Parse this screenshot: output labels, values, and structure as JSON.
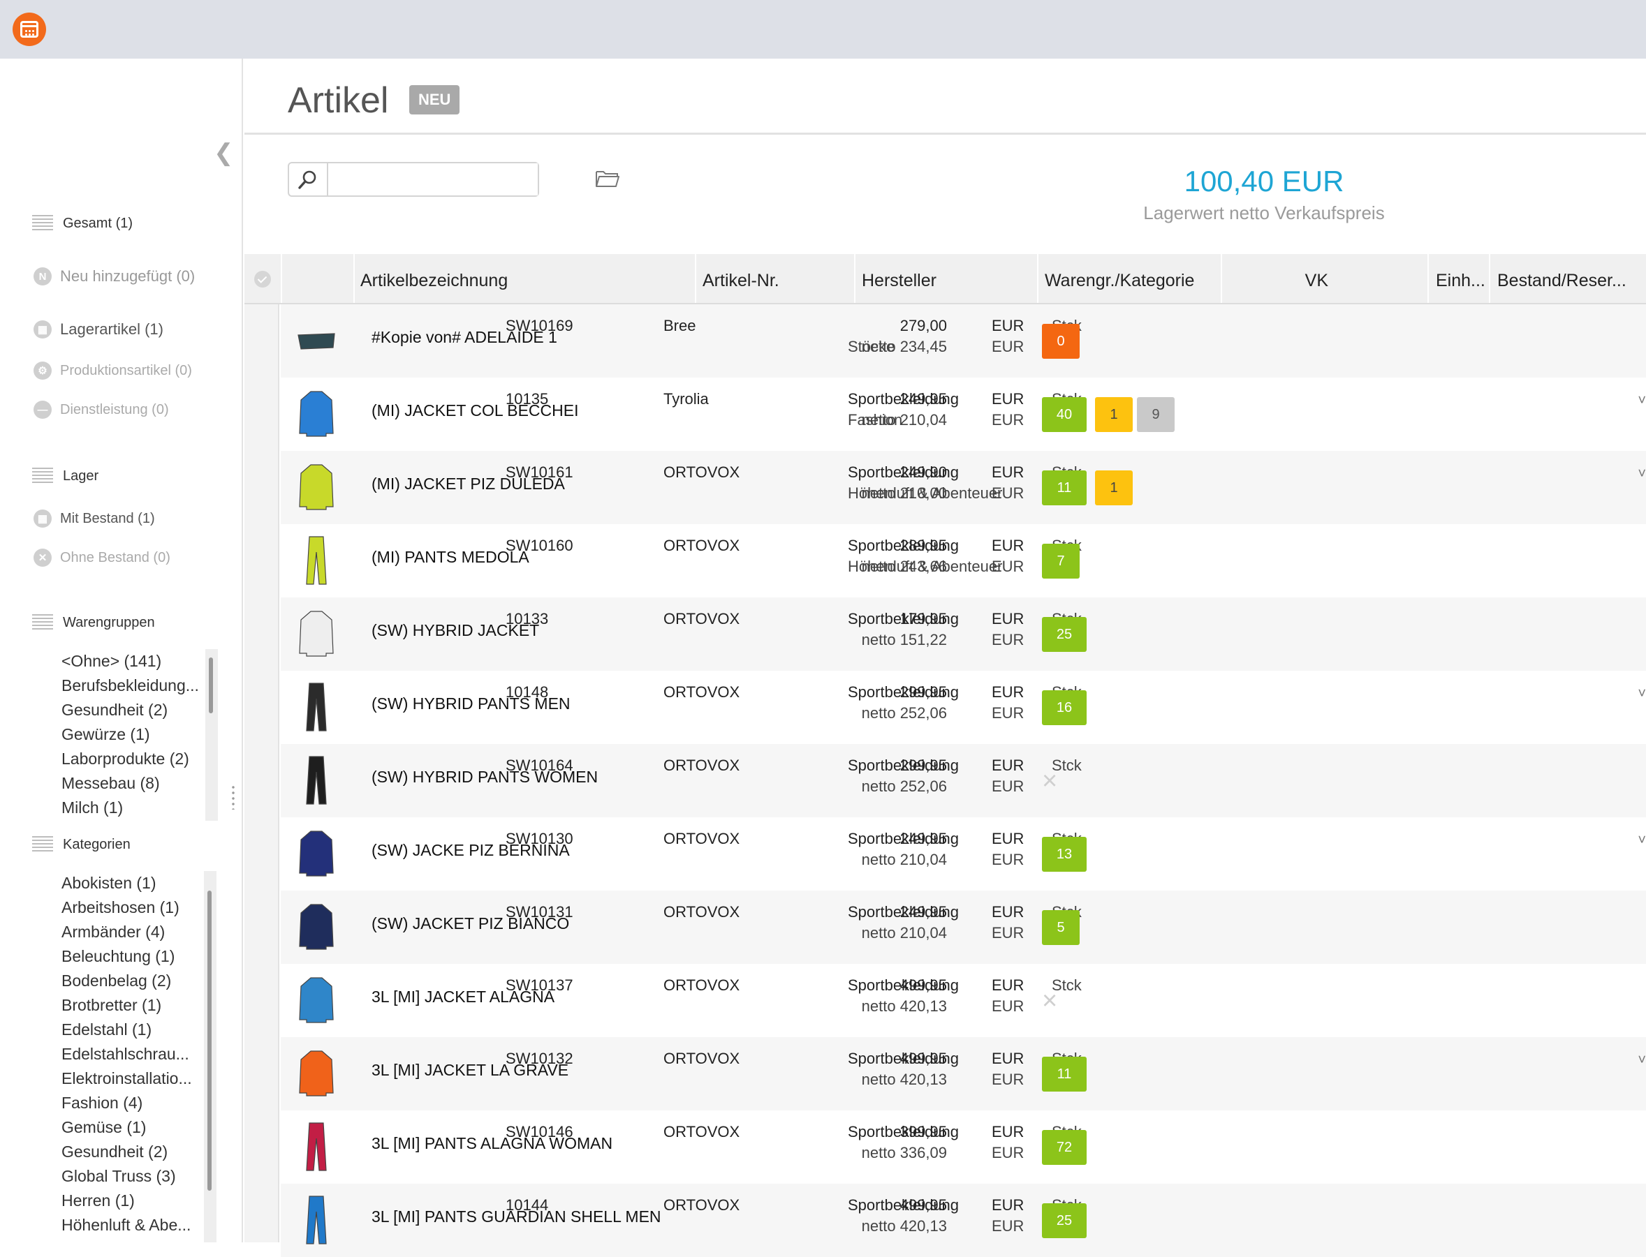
{
  "sidebar": {
    "gesamt": "Gesamt (1)",
    "neu": "Neu hinzugefügt (0)",
    "lagerartikel": "Lagerartikel (1)",
    "produktion": "Produktionsartikel (0)",
    "dienstleistung": "Dienstleistung (0)",
    "lager": "Lager",
    "mit_bestand": "Mit Bestand (1)",
    "ohne_bestand": "Ohne Bestand (0)",
    "warengruppen": "Warengruppen",
    "warengruppen_items": [
      "<Ohne> (141)",
      "Berufsbekleidung...",
      "Gesundheit (2)",
      "Gewürze (1)",
      "Laborprodukte (2)",
      "Messebau (8)",
      "Milch (1)"
    ],
    "kategorien": "Kategorien",
    "kategorien_items": [
      "Abokisten (1)",
      "Arbeitshosen (1)",
      "Armbänder (4)",
      "Beleuchtung (1)",
      "Bodenbelag (2)",
      "Brotbretter (1)",
      "Edelstahl (1)",
      "Edelstahlschrau...",
      "Elektroinstallatio...",
      "Fashion (4)",
      "Gemüse (1)",
      "Gesundheit (2)",
      "Global Truss (3)",
      "Herren (1)",
      "Höhenluft & Abe..."
    ]
  },
  "header": {
    "title": "Artikel",
    "badge": "NEU",
    "stock_value": "100,40 EUR",
    "stock_label": "Lagerwert netto Verkaufspreis"
  },
  "search": {
    "placeholder": ""
  },
  "table": {
    "columns": {
      "name": "Artikelbezeichnung",
      "nr": "Artikel-Nr.",
      "manufacturer": "Hersteller",
      "category": "Warengr./Kategorie",
      "vk": "VK",
      "unit": "Einh...",
      "stock": "Bestand/Reser..."
    },
    "rows": [
      {
        "name": "#Kopie von# ADELAIDE 1",
        "nr": "SW10169",
        "manufacturer": "Bree",
        "cat1": "",
        "cat2": "Stöcke",
        "vk": "279,00",
        "netto": "netto 234,45",
        "cur": "EUR",
        "unit": "Stck",
        "stock": [
          {
            "v": "0",
            "type": "orange"
          }
        ],
        "img": "bag",
        "color": "#2f4a52"
      },
      {
        "name": "(MI) JACKET COL BECCHEI",
        "nr": "10135",
        "manufacturer": "Tyrolia",
        "cat1": "Sportbekleidung",
        "cat2": "Fashion",
        "vk": "249,95",
        "netto": "netto 210,04",
        "cur": "EUR",
        "unit": "Stck",
        "stock": [
          {
            "v": "40",
            "type": "green"
          },
          {
            "v": "1",
            "type": "yellow"
          },
          {
            "v": "9",
            "type": "gray"
          }
        ],
        "img": "jacket",
        "color": "#2a7fd4",
        "caret": "˅"
      },
      {
        "name": "(MI) JACKET PIZ DULEDA",
        "nr": "SW10161",
        "manufacturer": "ORTOVOX",
        "cat1": "Sportbekleidung",
        "cat2": "Höhenluft & Abenteuer",
        "vk": "249,90",
        "netto": "netto 210,00",
        "cur": "EUR",
        "unit": "Stck",
        "stock": [
          {
            "v": "11",
            "type": "green"
          },
          {
            "v": "1",
            "type": "yellow"
          }
        ],
        "img": "jacket",
        "color": "#c8d92a",
        "caret": "˅"
      },
      {
        "name": "(MI) PANTS MEDOLA",
        "nr": "SW10160",
        "manufacturer": "ORTOVOX",
        "cat1": "Sportbekleidung",
        "cat2": "Höhenluft & Abenteuer",
        "vk": "289,95",
        "netto": "netto 243,66",
        "cur": "EUR",
        "unit": "Stck",
        "stock": [
          {
            "v": "7",
            "type": "green"
          }
        ],
        "img": "pants",
        "color": "#c8d92a"
      },
      {
        "name": "(SW) HYBRID JACKET",
        "nr": "10133",
        "manufacturer": "ORTOVOX",
        "cat1": "Sportbekleidung",
        "cat2": "",
        "vk": "179,95",
        "netto": "netto 151,22",
        "cur": "EUR",
        "unit": "Stck",
        "stock": [
          {
            "v": "25",
            "type": "green"
          }
        ],
        "img": "jacket",
        "color": "#eeeeee"
      },
      {
        "name": "(SW) HYBRID PANTS MEN",
        "nr": "10148",
        "manufacturer": "ORTOVOX",
        "cat1": "Sportbekleidung",
        "cat2": "",
        "vk": "299,95",
        "netto": "netto 252,06",
        "cur": "EUR",
        "unit": "Stck",
        "stock": [
          {
            "v": "16",
            "type": "green"
          }
        ],
        "img": "pants",
        "color": "#2b2b2b",
        "caret": "˅"
      },
      {
        "name": "(SW) HYBRID PANTS WOMEN",
        "nr": "SW10164",
        "manufacturer": "ORTOVOX",
        "cat1": "Sportbekleidung",
        "cat2": "",
        "vk": "299,95",
        "netto": "netto 252,06",
        "cur": "EUR",
        "unit": "Stck",
        "stock": [],
        "img": "pants",
        "color": "#1e1e1e"
      },
      {
        "name": "(SW) JACKE PIZ BERNINA",
        "nr": "SW10130",
        "manufacturer": "ORTOVOX",
        "cat1": "Sportbekleidung",
        "cat2": "",
        "vk": "249,95",
        "netto": "netto 210,04",
        "cur": "EUR",
        "unit": "Stck",
        "stock": [
          {
            "v": "13",
            "type": "green"
          }
        ],
        "img": "jacket",
        "color": "#23307a",
        "caret": "˅"
      },
      {
        "name": "(SW) JACKET PIZ BIANCO",
        "nr": "SW10131",
        "manufacturer": "ORTOVOX",
        "cat1": "Sportbekleidung",
        "cat2": "",
        "vk": "249,95",
        "netto": "netto 210,04",
        "cur": "EUR",
        "unit": "Stck",
        "stock": [
          {
            "v": "5",
            "type": "green"
          }
        ],
        "img": "jacket",
        "color": "#1f2d5c"
      },
      {
        "name": "3L [MI] JACKET ALAGNA",
        "nr": "SW10137",
        "manufacturer": "ORTOVOX",
        "cat1": "Sportbekleidung",
        "cat2": "",
        "vk": "499,95",
        "netto": "netto 420,13",
        "cur": "EUR",
        "unit": "Stck",
        "stock": [],
        "img": "jacket",
        "color": "#2f86c9"
      },
      {
        "name": "3L [MI] JACKET LA GRAVE",
        "nr": "SW10132",
        "manufacturer": "ORTOVOX",
        "cat1": "Sportbekleidung",
        "cat2": "",
        "vk": "499,95",
        "netto": "netto 420,13",
        "cur": "EUR",
        "unit": "Stck",
        "stock": [
          {
            "v": "11",
            "type": "green"
          }
        ],
        "img": "jacket",
        "color": "#f0621a",
        "caret": "˅"
      },
      {
        "name": "3L [MI] PANTS ALAGNA WOMAN",
        "nr": "SW10146",
        "manufacturer": "ORTOVOX",
        "cat1": "Sportbekleidung",
        "cat2": "",
        "vk": "399,95",
        "netto": "netto 336,09",
        "cur": "EUR",
        "unit": "Stck",
        "stock": [
          {
            "v": "72",
            "type": "green"
          }
        ],
        "img": "pants",
        "color": "#c21e45"
      },
      {
        "name": "3L [MI] PANTS GUARDIAN SHELL MEN",
        "nr": "10144",
        "manufacturer": "ORTOVOX",
        "cat1": "Sportbekleidung",
        "cat2": "",
        "vk": "499,95",
        "netto": "netto 420,13",
        "cur": "EUR",
        "unit": "Stck",
        "stock": [
          {
            "v": "25",
            "type": "green"
          }
        ],
        "img": "pants",
        "color": "#2079c9"
      }
    ]
  }
}
